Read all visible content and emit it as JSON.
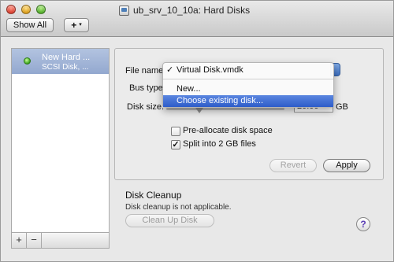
{
  "window": {
    "title": "ub_srv_10_10a: Hard Disks"
  },
  "toolbar": {
    "show_all_label": "Show All",
    "add_label": "+",
    "dropdown_glyph": "▾"
  },
  "sidebar": {
    "items": [
      {
        "name": "New Hard ...",
        "subtitle": "SCSI Disk, ...",
        "status": "green"
      }
    ],
    "add_label": "+",
    "remove_label": "−"
  },
  "settings": {
    "file_name_label": "File name",
    "bus_type_label": "Bus type",
    "disk_size_label": "Disk size:",
    "disk_size_value": "20.00",
    "disk_size_unit": "GB",
    "preallocate_label": "Pre-allocate disk space",
    "preallocate_checked": false,
    "split_label": "Split into 2 GB files",
    "split_checked": true,
    "check_glyph": "✓",
    "revert_label": "Revert",
    "apply_label": "Apply"
  },
  "file_menu": {
    "selected_check": "✓",
    "items": [
      "Virtual Disk.vmdk",
      "New...",
      "Choose existing disk..."
    ],
    "selected": "Virtual Disk.vmdk",
    "highlighted": "Choose existing disk..."
  },
  "cleanup": {
    "heading": "Disk Cleanup",
    "note": "Disk cleanup is not applicable.",
    "button_label": "Clean Up Disk"
  },
  "help": {
    "label": "?"
  },
  "colors": {
    "selection": "#2d5cc9",
    "sidebar_selection": "#93a8cf",
    "status_green": "#3aa21c",
    "help_glyph": "#5a3db5"
  }
}
